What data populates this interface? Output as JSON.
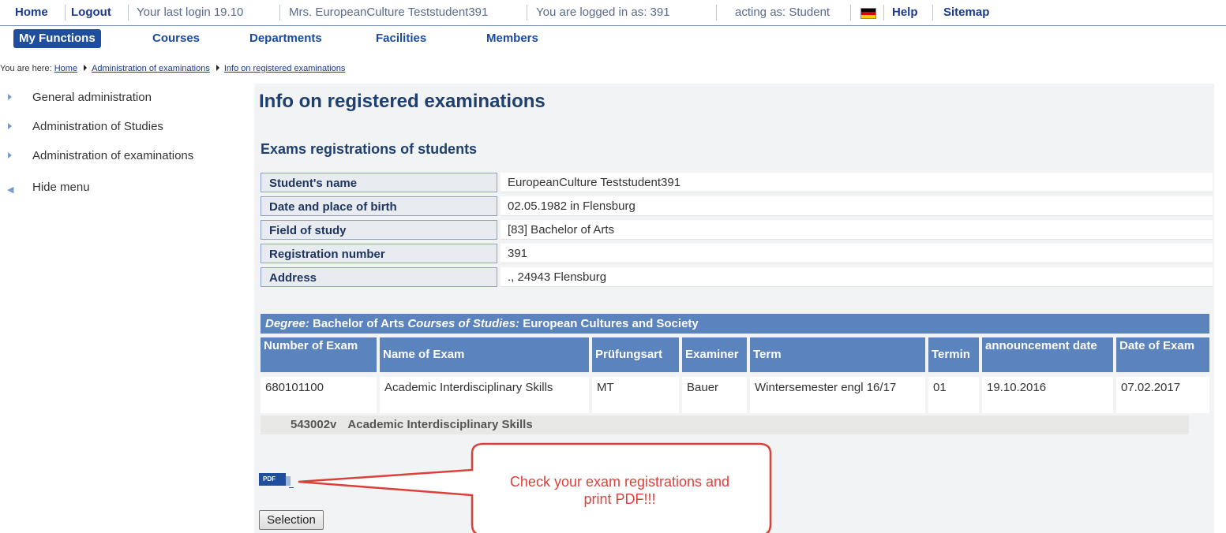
{
  "topbar": {
    "home": "Home",
    "logout": "Logout",
    "last_login": "Your last login  19.10",
    "user": "Mrs. EuropeanCulture Teststudent391",
    "logged_in_as": "You are logged in as:  391",
    "acting_as": "acting as: Student",
    "help": "Help",
    "sitemap": "Sitemap",
    "flag_colors": [
      "#000000",
      "#dd0000",
      "#ffce00"
    ]
  },
  "nav": {
    "tabs": [
      "My Functions",
      "Courses",
      "Departments",
      "Facilities",
      "Members"
    ],
    "active": "My Functions"
  },
  "breadcrumb": {
    "prefix": "You are here:",
    "items": [
      "Home",
      "Administration of examinations",
      "Info on registered examinations"
    ]
  },
  "sidebar": {
    "items": [
      "General administration",
      "Administration of Studies",
      "Administration of examinations"
    ],
    "hide_menu": "Hide menu"
  },
  "main": {
    "title": "Info on registered examinations",
    "subtitle": "Exams registrations of students",
    "info": [
      {
        "label": "Student's name",
        "value": "EuropeanCulture Teststudent391"
      },
      {
        "label": "Date and place of birth",
        "value": "02.05.1982 in Flensburg"
      },
      {
        "label": "Field of study",
        "value": "[83] Bachelor of Arts"
      },
      {
        "label": "Registration number",
        "value": "391"
      },
      {
        "label": "Address",
        "value": "., 24943 Flensburg"
      }
    ],
    "degree_bar": {
      "degree_label": "Degree:",
      "degree_value": "Bachelor of Arts",
      "courses_label": "Courses of Studies:",
      "courses_value": "European Cultures and Society"
    },
    "exam_table": {
      "headers": [
        "Number of Exam",
        "Name of Exam",
        "Prüfungsart",
        "Examiner",
        "Term",
        "Termin",
        "announcement date",
        "Date of Exam"
      ],
      "rows": [
        [
          "680101100",
          "Academic Interdisciplinary Skills",
          "MT",
          "Bauer",
          "Wintersemester engl 16/17",
          "01",
          "19.10.2016",
          "07.02.2017"
        ]
      ],
      "subrow": {
        "number": "543002v",
        "name": "Academic Interdisciplinary Skills"
      }
    },
    "pdf_icon_label": "PDF",
    "selection_button": "Selection"
  },
  "callout": {
    "line1": "Check your exam registrations and",
    "line2": "print PDF!!!",
    "color": "#e0403a"
  }
}
